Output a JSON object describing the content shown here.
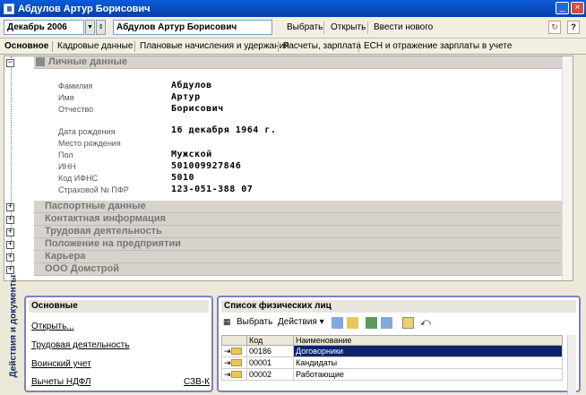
{
  "window": {
    "title": "Абдулов Артур Борисович",
    "min": "_",
    "max": "□",
    "close": "×"
  },
  "toolbar": {
    "period": "Декабрь 2006",
    "person": "Абдулов Артур Борисович",
    "select": "Выбрать",
    "open": "Открыть",
    "new": "Ввести нового",
    "help": "?"
  },
  "tabs": [
    "Основное",
    "Кадровые данные",
    "Плановые начисления и удержания",
    "Расчеты, зарплата",
    "ЕСН и отражение зарплаты в учете"
  ],
  "personal": {
    "title": "Личные данные",
    "rows": [
      {
        "label": "Фамилия",
        "value": "Абдулов"
      },
      {
        "label": "Имя",
        "value": "Артур"
      },
      {
        "label": "Отчество",
        "value": "Борисович"
      },
      {
        "label": "Дата рождения",
        "value": "16 декабря 1964 г."
      },
      {
        "label": "Место рождения",
        "value": ""
      },
      {
        "label": "Пол",
        "value": "Мужской"
      },
      {
        "label": "ИНН",
        "value": "501009927846"
      },
      {
        "label": "Код ИФНС",
        "value": "5010"
      },
      {
        "label": "Страховой № ПФР",
        "value": "123-051-388 07"
      }
    ]
  },
  "sections": [
    "Паспортные данные",
    "Контактная информация",
    "Трудовая деятельность",
    "Положение на предприятии",
    "Карьера",
    "ООО Домстрой"
  ],
  "actions_label": "Действия и документы",
  "main_panel": {
    "title": "Основные",
    "links": [
      "Открыть...",
      "Трудовая деятельность",
      "Воинский учет",
      "Вычеты НДФЛ",
      "СЗВ-К"
    ]
  },
  "list_panel": {
    "title": "Список физических лиц",
    "select": "Выбрать",
    "actions": "Действия",
    "columns": [
      "Код",
      "Наименование"
    ],
    "rows": [
      {
        "code": "00186",
        "name": "Договорники"
      },
      {
        "code": "00001",
        "name": "Кандидаты"
      },
      {
        "code": "00002",
        "name": "Работающие"
      }
    ]
  }
}
